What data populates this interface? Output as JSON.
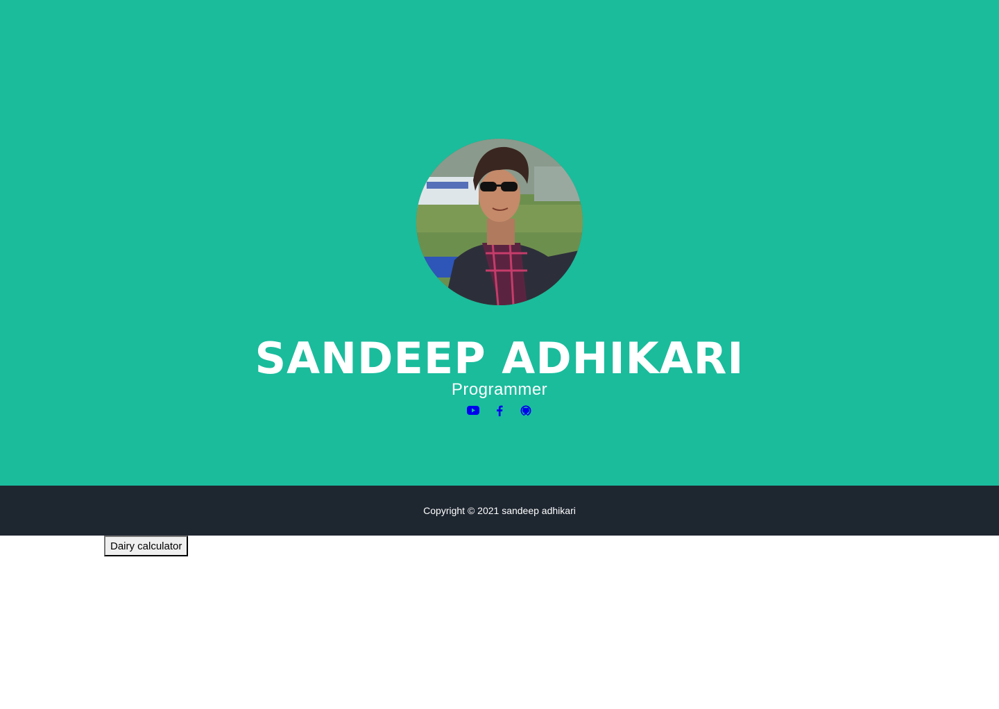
{
  "profile": {
    "name": "SANDEEP ADHIKARI",
    "role": "Programmer",
    "avatar_alt": "profile photo"
  },
  "socials": [
    {
      "icon": "youtube-icon",
      "label": "YouTube"
    },
    {
      "icon": "facebook-icon",
      "label": "Facebook"
    },
    {
      "icon": "github-icon",
      "label": "GitHub"
    }
  ],
  "footer": {
    "copyright": "Copyright © 2021 sandeep adhikari"
  },
  "actions": {
    "dairy_calculator_label": "Dairy calculator"
  },
  "colors": {
    "hero_bg": "#1abc9c",
    "footer_bg": "#1e2630",
    "link": "#0000ee"
  }
}
